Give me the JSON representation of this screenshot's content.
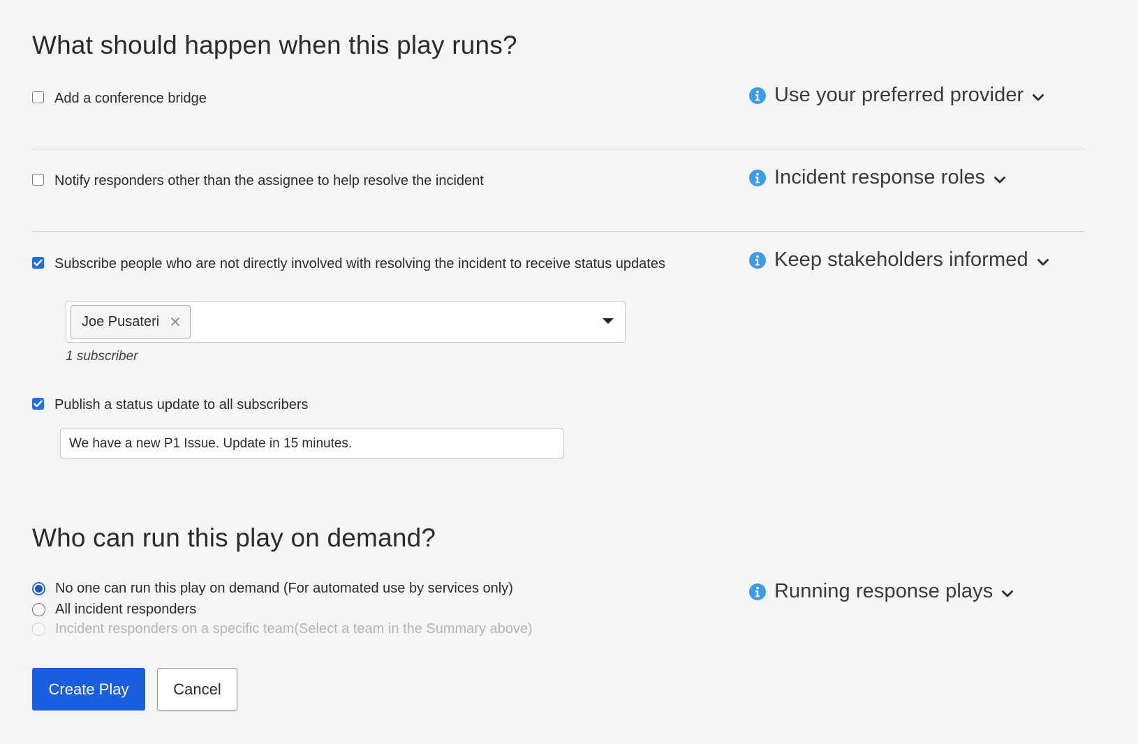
{
  "section1": {
    "heading": "What should happen when this play runs?"
  },
  "options": {
    "conference_bridge": {
      "checked": false,
      "label": "Add a conference bridge",
      "help": "Use your preferred provider"
    },
    "notify_responders": {
      "checked": false,
      "label": "Notify responders other than the assignee to help resolve the incident",
      "help": "Incident response roles"
    },
    "subscribe": {
      "checked": true,
      "label": "Subscribe people who are not directly involved with resolving the incident to receive status updates",
      "help": "Keep stakeholders informed",
      "subscribers": [
        "Joe Pusateri"
      ],
      "count_text": "1 subscriber"
    },
    "publish": {
      "checked": true,
      "label": "Publish a status update to all subscribers",
      "message": "We have a new P1 Issue. Update in 15 minutes."
    }
  },
  "section2": {
    "heading": "Who can run this play on demand?",
    "help": "Running response plays",
    "radios": [
      {
        "label": "No one can run this play on demand (For automated use by services only)",
        "selected": true,
        "disabled": false
      },
      {
        "label": "All incident responders",
        "selected": false,
        "disabled": false
      },
      {
        "label": "Incident responders on a specific team(Select a team in the Summary above)",
        "selected": false,
        "disabled": true
      }
    ]
  },
  "buttons": {
    "create": "Create Play",
    "cancel": "Cancel"
  },
  "colors": {
    "accent": "#1a5fe0",
    "info": "#3d9be9",
    "background": "#f5f5f5"
  },
  "icons": {
    "info": "info-icon",
    "chevron": "chevron-down-icon",
    "remove": "close-icon",
    "caret": "caret-down-icon",
    "check": "checkmark-icon"
  }
}
